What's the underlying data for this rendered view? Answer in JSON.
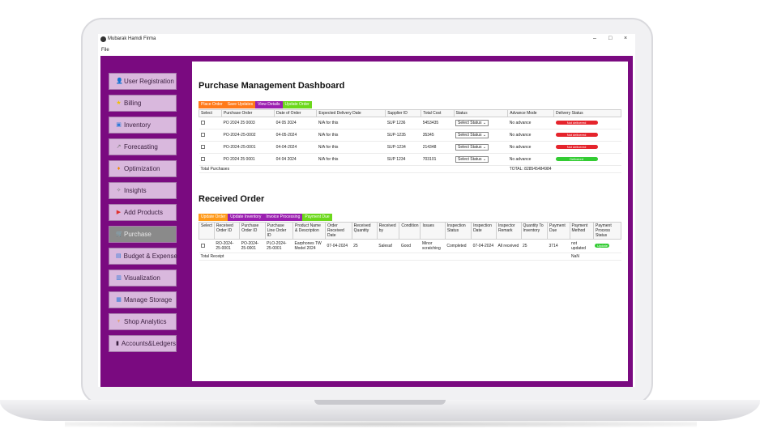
{
  "window": {
    "title": "Mubarak Hamdi Firma",
    "menu_label": "File",
    "minimize": "–",
    "maximize": "□",
    "close": "×"
  },
  "sidebar": {
    "items": [
      {
        "label": "User Registration",
        "icon": "user-icon",
        "glyph": "👤",
        "color": "#3a1f3f"
      },
      {
        "label": "Billing",
        "icon": "star-icon",
        "glyph": "★",
        "color": "#f0c000"
      },
      {
        "label": "Inventory",
        "icon": "box-icon",
        "glyph": "▣",
        "color": "#2f7ad8"
      },
      {
        "label": "Forecasting",
        "icon": "trend-icon",
        "glyph": "↗",
        "color": "#777777"
      },
      {
        "label": "Optimization",
        "icon": "flame-icon",
        "glyph": "♦",
        "color": "#f08a00"
      },
      {
        "label": "Insights",
        "icon": "sparkle-icon",
        "glyph": "✧",
        "color": "#777777"
      },
      {
        "label": "Add Products",
        "icon": "play-icon",
        "glyph": "▶",
        "color": "#e0302c"
      },
      {
        "label": "Purchase",
        "icon": "cart-icon",
        "glyph": "🛒",
        "color": "#e8e8e8"
      },
      {
        "label": "Budget & Expense",
        "icon": "budget-icon",
        "glyph": "▤",
        "color": "#2f7ad8"
      },
      {
        "label": "Visualization",
        "icon": "bar-chart-icon",
        "glyph": "▥",
        "color": "#2f7ad8"
      },
      {
        "label": "Manage Storage",
        "icon": "storage-icon",
        "glyph": "▦",
        "color": "#2f7ad8"
      },
      {
        "label": "Shop Analytics",
        "icon": "tree-icon",
        "glyph": "♆",
        "color": "#f08a00"
      },
      {
        "label": "Accounts&Ledgers",
        "icon": "phone-icon",
        "glyph": "▮",
        "color": "#3a1f3f"
      }
    ],
    "active_index": 7
  },
  "purchase": {
    "title": "Purchase Management Dashboard",
    "buttons": [
      {
        "label": "Place Order",
        "color": "#ff7a1a"
      },
      {
        "label": "Save Updates",
        "color": "#ff7a1a"
      },
      {
        "label": "View Details",
        "color": "#9b1fb0"
      },
      {
        "label": "Update Order",
        "color": "#6cd81c"
      }
    ],
    "headers": [
      "Select",
      "Purchase Order",
      "Date of Order",
      "Expected Delivery Date",
      "Supplier ID",
      "Total Cost",
      "Status",
      "Advance Mode",
      "Delivery Status"
    ],
    "rows": [
      {
        "po": "PO 2024 25 0003",
        "date": "04 05 2024",
        "expected": "N/A for this",
        "supplier": "SUP 1236",
        "cost": "5453435",
        "status": "Select Status",
        "advance": "No advance",
        "delivery": "Not delivered",
        "delivery_color": "red"
      },
      {
        "po": "PO-2024-25-0002",
        "date": "04-05-2024",
        "expected": "N/A for this",
        "supplier": "SUP-1235",
        "cost": "35345",
        "status": "Select Status",
        "advance": "No advance",
        "delivery": "Not delivered",
        "delivery_color": "red"
      },
      {
        "po": "PO-2024-25-0001",
        "date": "04-04-2024",
        "expected": "N/A for this",
        "supplier": "SUP-1234",
        "cost": "214348",
        "status": "Select Status",
        "advance": "No advance",
        "delivery": "Not delivered",
        "delivery_color": "red"
      },
      {
        "po": "PO 2024 25 0001",
        "date": "04 04 2024",
        "expected": "N/A for this",
        "supplier": "SUP 1234",
        "cost": "703101",
        "status": "Select Status",
        "advance": "No advance",
        "delivery": "Delivered",
        "delivery_color": "green"
      }
    ],
    "total_label": "Total Purchases",
    "total_value": "TOTAL: 828545484984"
  },
  "received": {
    "title": "Received Order",
    "buttons": [
      {
        "label": "Update Order",
        "color": "#ff9a1a"
      },
      {
        "label": "Update Inventory",
        "color": "#9b1fb0"
      },
      {
        "label": "Invoice Processing",
        "color": "#9b1fb0"
      },
      {
        "label": "Payment Due",
        "color": "#6cd81c"
      }
    ],
    "headers": [
      "Select",
      "Received Order ID",
      "Purchase Order ID",
      "Purchase Line Order ID",
      "Product Name & Description",
      "Order Received Date",
      "Received Quantity",
      "Received by",
      "Condition",
      "Issues",
      "Inspection Status",
      "Inspection Date",
      "Inspector Remark",
      "Quantity To Inventory",
      "Payment Due",
      "Payment Method",
      "Payment Process Status"
    ],
    "row": {
      "ro": "RO-2024-25-0001",
      "po": "PO-2024-25-0001",
      "pl": "PLO-2024-25-0001",
      "product": "Earphones TW Model 2024",
      "date": "07-04-2024",
      "qty": "25",
      "by": "Salesaf",
      "condition": "Good",
      "issues": "Minor scratching",
      "insp_status": "Completed",
      "insp_date": "07-04-2024",
      "remark": "All received",
      "to_inv": "25",
      "due": "3714",
      "method": "not updated",
      "process": "Update"
    },
    "total_label": "Total Receipt",
    "total_value": "NaN"
  }
}
